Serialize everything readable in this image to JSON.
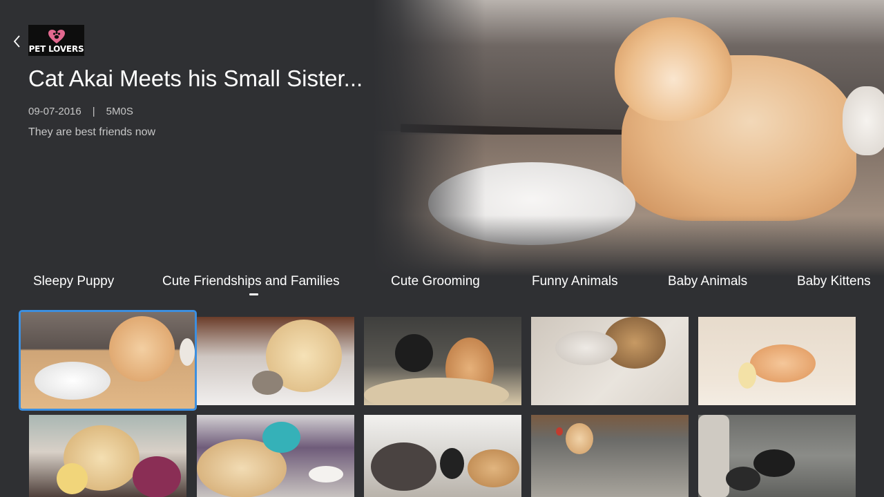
{
  "header": {
    "logo_text": "PET LOVERS",
    "title": "Cat Akai Meets his Small Sister...",
    "date": "09-07-2016",
    "separator": "|",
    "duration": "5M0S",
    "description": "They are best friends now"
  },
  "tabs": [
    {
      "label": "Sleepy Puppy"
    },
    {
      "label": "Cute Friendships and Families",
      "selected": true
    },
    {
      "label": "Cute Grooming"
    },
    {
      "label": "Funny Animals"
    },
    {
      "label": "Baby Animals"
    },
    {
      "label": "Baby Kittens"
    }
  ],
  "colors": {
    "background": "#2f3033",
    "selection_outline": "#3c8fe0",
    "logo_heart": "#e2688f"
  },
  "icons": {
    "back": "chevron-left-icon",
    "logo_heart": "paw-heart-icon"
  }
}
